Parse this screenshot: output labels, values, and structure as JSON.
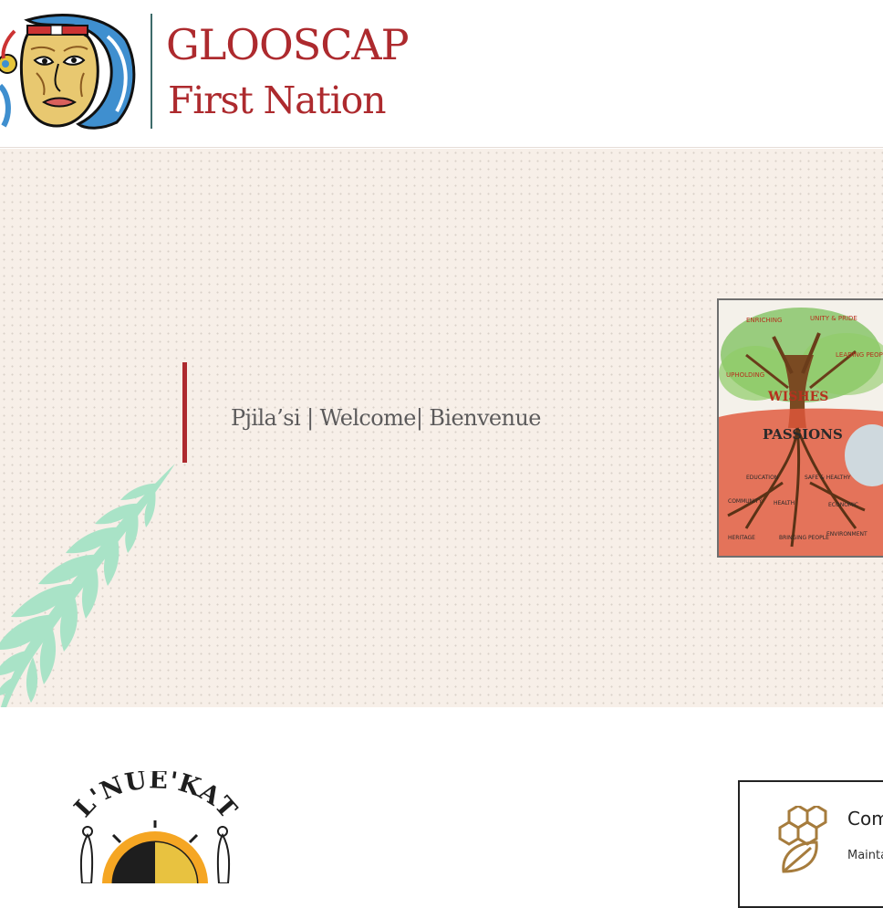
{
  "header": {
    "logo_title": "GLOOSCAP",
    "logo_subtitle": "First Nation"
  },
  "hero": {
    "welcome_text": "Pjila’si | Welcome| Bienvenue",
    "image_label": "Wishes and Passions tree illustration"
  },
  "lower": {
    "partner_logo_text": "L'NUE'KATI",
    "card": {
      "title": "Com",
      "text": "Mainta",
      "icon": "honeycomb-leaf-icon"
    }
  },
  "colors": {
    "brand_red": "#ad2a2e",
    "divider_teal": "#3d6b6a",
    "hero_background": "#f7efe8",
    "fern_green": "#a9e3c7"
  }
}
